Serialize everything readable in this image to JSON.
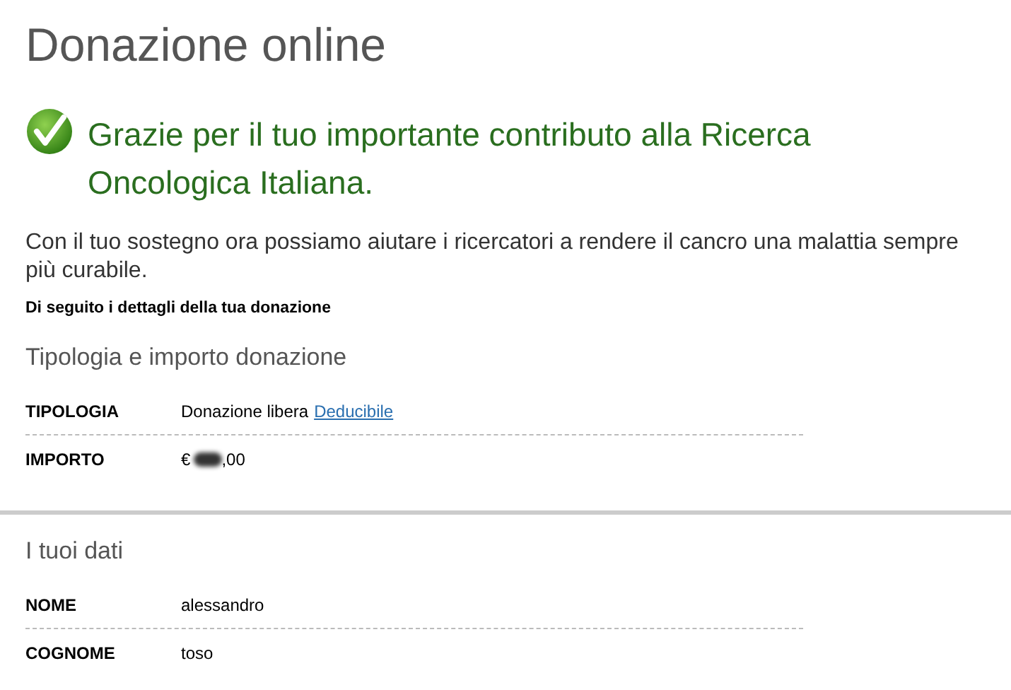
{
  "page_title": "Donazione online",
  "success_message": "Grazie per il tuo importante contributo alla Ricerca Oncologica Italiana.",
  "intro": "Con il tuo sostegno ora possiamo aiutare i ricercatori a rendere il cancro una malattia sempre più curabile.",
  "details_caption": "Di seguito i dettagli della tua donazione",
  "sections": [
    {
      "title": "Tipologia e importo donazione",
      "rows": [
        {
          "kind": "text_link",
          "label": "TIPOLOGIA",
          "value": "Donazione libera",
          "link": "Deducibile"
        },
        {
          "kind": "amount",
          "label": "IMPORTO",
          "prefix": "€",
          "suffix": ",00",
          "redacted": true
        }
      ]
    },
    {
      "title": "I tuoi dati",
      "rows": [
        {
          "kind": "text",
          "label": "NOME",
          "value": "alessandro"
        },
        {
          "kind": "text",
          "label": "COGNOME",
          "value": "toso"
        }
      ]
    }
  ]
}
